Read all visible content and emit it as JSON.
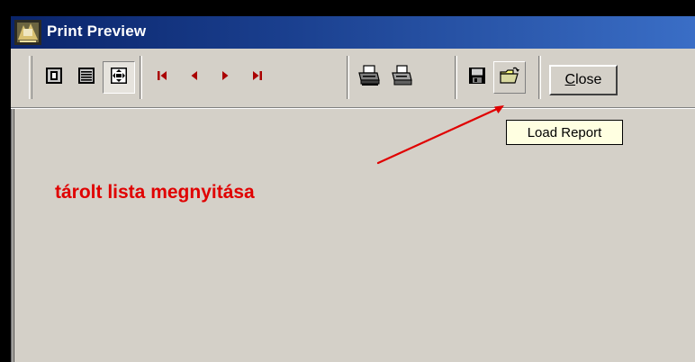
{
  "window": {
    "title": "Print Preview",
    "title_bar_color": "#0a246a",
    "face_color": "#d4d0c8"
  },
  "toolbar": {
    "buttons": [
      {
        "id": "one-page",
        "icon": "single-page-icon"
      },
      {
        "id": "two-pages",
        "icon": "text-page-icon"
      },
      {
        "id": "zoom",
        "icon": "fit-page-icon",
        "state": "pressed"
      },
      {
        "id": "first",
        "icon": "first-page-icon"
      },
      {
        "id": "prev",
        "icon": "prev-page-icon"
      },
      {
        "id": "next",
        "icon": "next-page-icon"
      },
      {
        "id": "last",
        "icon": "last-page-icon"
      },
      {
        "id": "print-setup",
        "icon": "print-setup-icon"
      },
      {
        "id": "print",
        "icon": "printer-icon"
      },
      {
        "id": "save",
        "icon": "floppy-disk-icon"
      },
      {
        "id": "load",
        "icon": "open-folder-icon",
        "state": "hover"
      }
    ],
    "nav_arrow_color": "#aa0000",
    "close_label_mnemonic": "C",
    "close_label_rest": "lose"
  },
  "tooltip": {
    "text": "Load Report"
  },
  "annotation": {
    "text": "tárolt lista megnyitása",
    "color": "#e00000"
  }
}
